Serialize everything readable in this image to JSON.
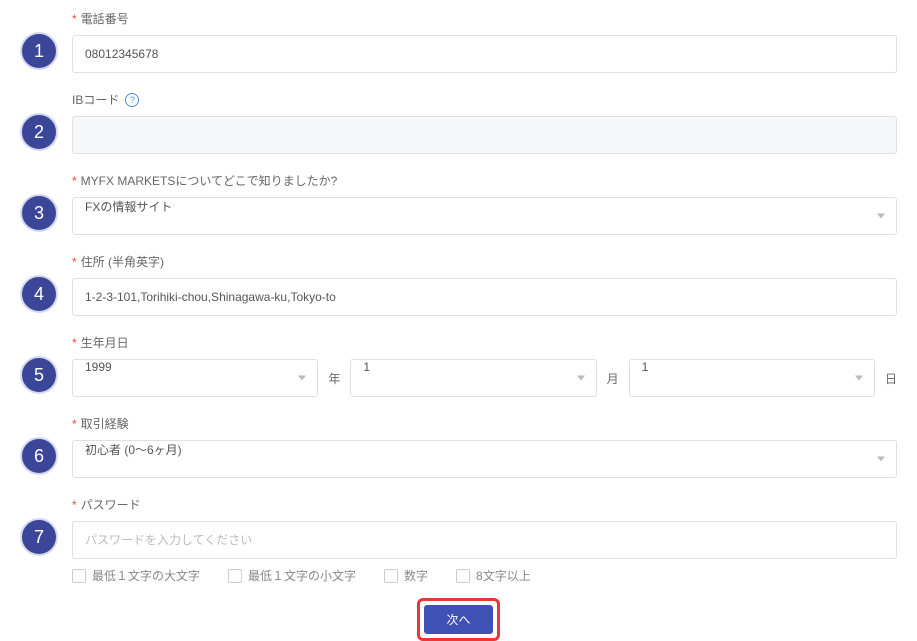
{
  "steps": {
    "s1": "1",
    "s2": "2",
    "s3": "3",
    "s4": "4",
    "s5": "5",
    "s6": "6",
    "s7": "7"
  },
  "phone": {
    "label": "電話番号",
    "value": "08012345678"
  },
  "ibcode": {
    "label": "IBコード"
  },
  "referral": {
    "label": "MYFX MARKETSについてどこで知りましたか?",
    "value": "FXの情報サイト"
  },
  "address": {
    "label": "住所 (半角英字)",
    "value": "1-2-3-101,Torihiki-chou,Shinagawa-ku,Tokyo-to"
  },
  "birthday": {
    "label": "生年月日",
    "year": "1999",
    "month": "1",
    "day": "1",
    "year_unit": "年",
    "month_unit": "月",
    "day_unit": "日"
  },
  "experience": {
    "label": "取引経験",
    "value": "初心者 (0〜6ヶ月)"
  },
  "password": {
    "label": "パスワード",
    "placeholder": "パスワードを入力してください",
    "rules": {
      "r1": "最低１文字の大文字",
      "r2": "最低１文字の小文字",
      "r3": "数字",
      "r4": "8文字以上"
    }
  },
  "submit": {
    "label": "次へ"
  }
}
